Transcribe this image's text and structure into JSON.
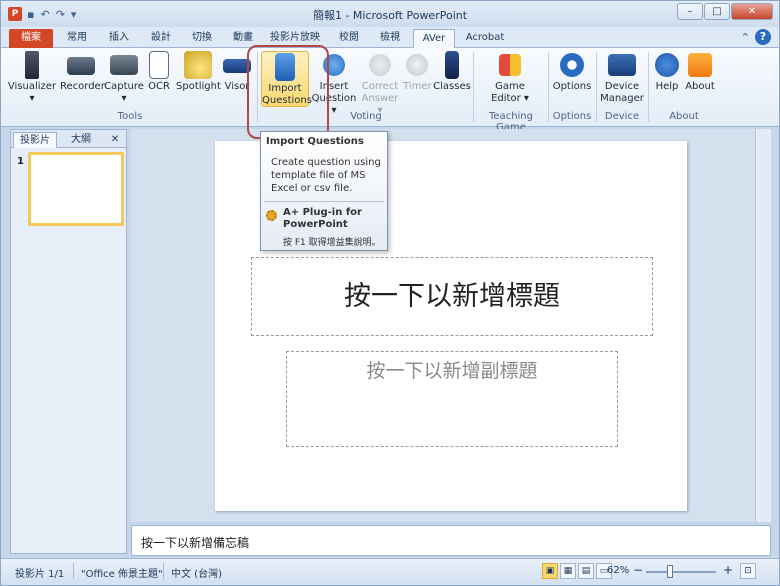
{
  "window": {
    "title": "簡報1 - Microsoft PowerPoint",
    "app_icon": "P",
    "qat": [
      "save-icon",
      "undo-icon",
      "redo-icon",
      "customize-icon"
    ],
    "buttons": {
      "minimize": "–",
      "maximize": "□",
      "close": "✕"
    }
  },
  "tabs": [
    "檔案",
    "常用",
    "插入",
    "設計",
    "切換",
    "動畫",
    "投影片放映",
    "校閱",
    "檢視",
    "AVer",
    "Acrobat"
  ],
  "active_tab": "AVer",
  "ribbon": {
    "tools": [
      {
        "label": "Visualizer",
        "icon": "visualizer-icon",
        "arrow": "▾"
      },
      {
        "label": "Recorder",
        "icon": "recorder-icon"
      },
      {
        "label": "Capture",
        "icon": "camera-icon",
        "arrow": "▾"
      },
      {
        "label": "OCR",
        "icon": "ocr-icon"
      },
      {
        "label": "Spotlight",
        "icon": "spotlight-icon"
      },
      {
        "label": "Visor",
        "icon": "visor-icon"
      }
    ],
    "voting": [
      {
        "label_line1": "Import",
        "label_line2": "Questions",
        "icon": "import-questions-icon"
      },
      {
        "label_line1": "Insert",
        "label_line2": "Question ▾",
        "icon": "quiz-icon"
      },
      {
        "label_line1": "Correct",
        "label_line2": "Answer ▾",
        "icon": "check-icon",
        "disabled": true
      },
      {
        "label_line1": "Timer",
        "label_line2": "",
        "icon": "timer-icon",
        "disabled": true
      },
      {
        "label_line1": "Classes",
        "label_line2": "",
        "icon": "classes-icon"
      }
    ],
    "teaching_game": {
      "label_line1": "Game",
      "label_line2": "Editor ▾",
      "icon": "game-editor-icon"
    },
    "options": {
      "label": "Options",
      "icon": "gear-icon"
    },
    "device": {
      "label_line1": "Device",
      "label_line2": "Manager",
      "icon": "device-manager-icon"
    },
    "about": [
      {
        "label": "Help",
        "icon": "help-icon"
      },
      {
        "label": "About",
        "icon": "about-icon"
      }
    ],
    "groups": [
      "Tools",
      "Voting",
      "Teaching Game",
      "Options",
      "Device",
      "About"
    ]
  },
  "tooltip": {
    "title": "Import Questions",
    "body": "Create question using template file of MS Excel or csv file.",
    "plugin": "A+ Plug-in for PowerPoint",
    "help": "按 F1 取得增益集說明。"
  },
  "left_pane": {
    "tabs": [
      "投影片",
      "大綱"
    ],
    "close": "✕",
    "slide_number": "1"
  },
  "slide": {
    "title_placeholder": "按一下以新增標題",
    "subtitle_placeholder": "按一下以新增副標題"
  },
  "notes_placeholder": "按一下以新增備忘稿",
  "status": {
    "slide": "投影片 1/1",
    "theme": "\"Office 佈景主題\"",
    "language": "中文 (台灣)",
    "zoom": "62%",
    "zoom_minus": "−",
    "zoom_plus": "+"
  }
}
